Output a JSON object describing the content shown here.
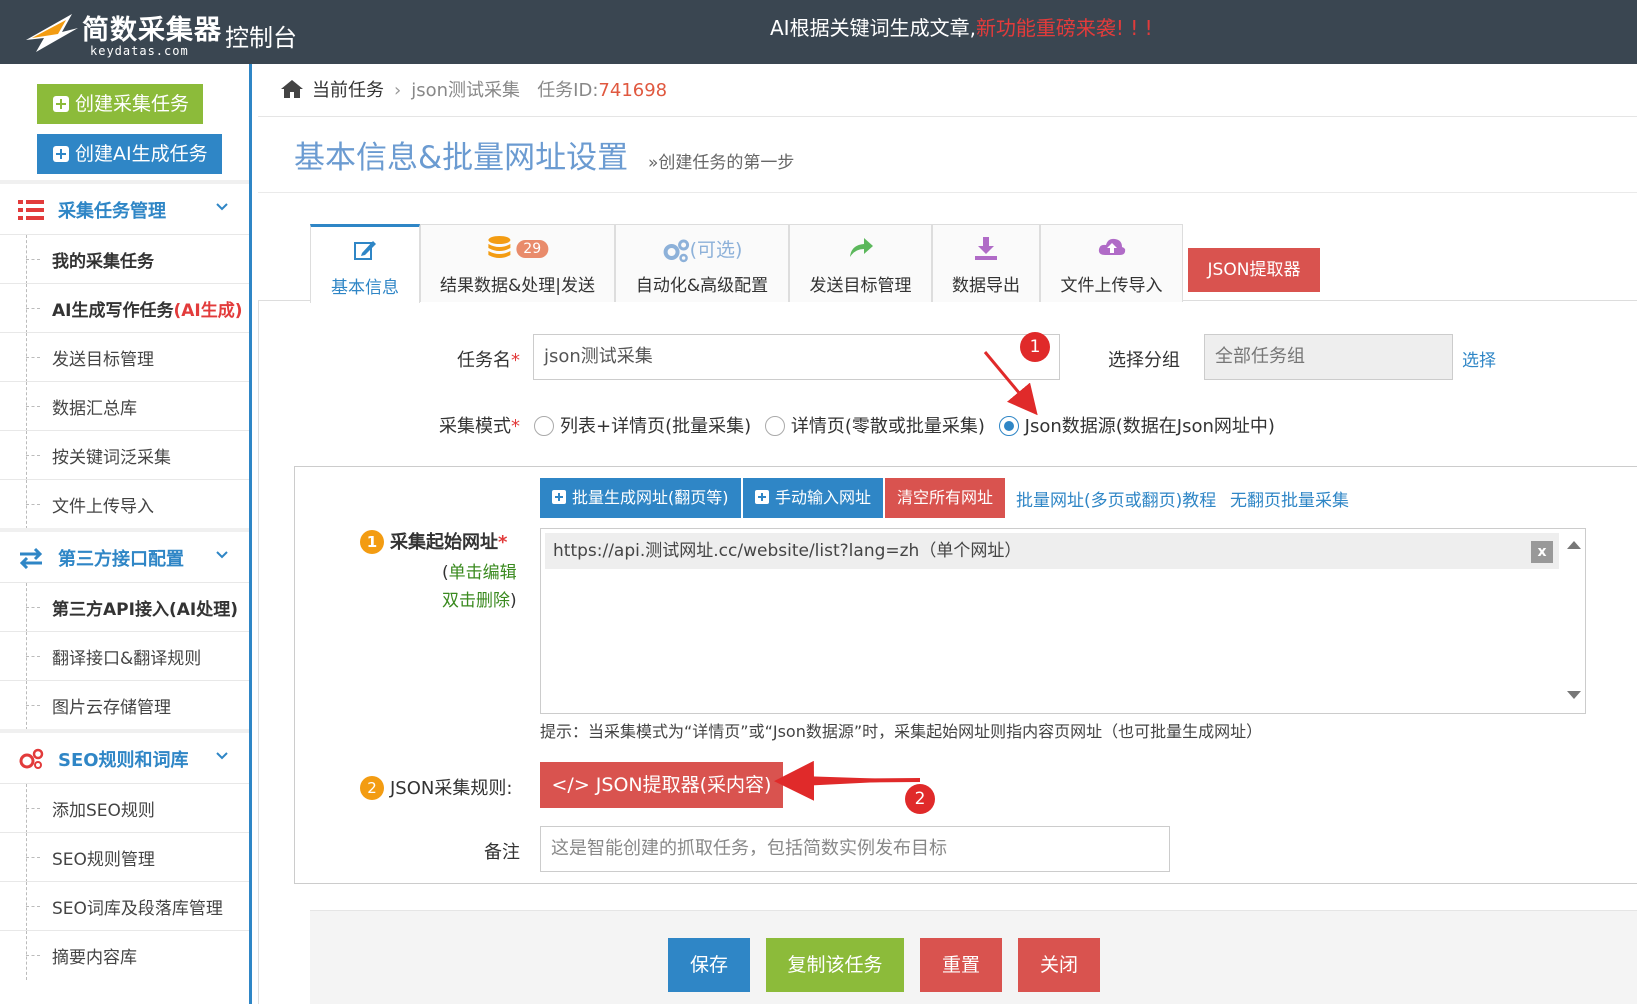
{
  "header": {
    "logo_text": "简数采集器",
    "logo_sub": "keydatas.com",
    "console_title": "控制台",
    "announce_main": "AI根据关键词生成文章,",
    "announce_hot": "新功能重磅来袭! ! !"
  },
  "sidebar": {
    "create_collect": "创建采集任务",
    "create_ai": "创建AI生成任务",
    "groups": [
      {
        "label": "采集任务管理",
        "icon": "list-icon"
      },
      {
        "label": "第三方接口配置",
        "icon": "exchange-icon"
      },
      {
        "label": "SEO规则和词库",
        "icon": "gears-icon"
      }
    ],
    "items_group1": [
      "我的采集任务",
      "AI生成写作任务",
      "发送目标管理",
      "数据汇总库",
      "按关键词泛采集",
      "文件上传导入"
    ],
    "ai_suffix": "(AI生成)",
    "items_group2": [
      "第三方API接入(AI处理)",
      "翻译接口&翻译规则",
      "图片云存储管理"
    ],
    "items_group3": [
      "添加SEO规则",
      "SEO规则管理",
      "SEO词库及段落库管理",
      "摘要内容库"
    ]
  },
  "breadcrumb": {
    "current": "当前任务",
    "task_name": "json测试采集",
    "task_id_label": "任务ID:",
    "task_id": "741698"
  },
  "page": {
    "title": "基本信息&批量网址设置",
    "subtitle": "»创建任务的第一步"
  },
  "tabs": [
    {
      "label": "基本信息",
      "icon": "edit-icon"
    },
    {
      "label": "结果数据&处理|发送",
      "icon": "database-icon",
      "badge": "29"
    },
    {
      "label": "自动化&高级配置",
      "icon": "gears-icon",
      "extra": "(可选)"
    },
    {
      "label": "发送目标管理",
      "icon": "share-icon"
    },
    {
      "label": "数据导出",
      "icon": "download-icon"
    },
    {
      "label": "文件上传导入",
      "icon": "cloud-upload-icon"
    }
  ],
  "json_tab_button": "JSON提取器",
  "form": {
    "task_name_label": "任务名",
    "task_name_value": "json测试采集",
    "group_label": "选择分组",
    "group_value": "全部任务组",
    "group_select_link": "选择",
    "mode_label": "采集模式",
    "modes": [
      "列表+详情页(批量采集)",
      "详情页(零散或批量采集)",
      "Json数据源(数据在Json网址中)"
    ],
    "mode_selected": 2,
    "btn_batch": "批量生成网址(翻页等)",
    "btn_manual": "手动输入网址",
    "btn_clear": "清空所有网址",
    "link_tutorial": "批量网址(多页或翻页)教程",
    "link_nopage": "无翻页批量采集",
    "start_url_num": "1",
    "start_url_label": "采集起始网址",
    "hint_paren_open": "(",
    "hint_edit": "单击编辑",
    "hint_delete": "双击删除",
    "hint_paren_close": ")",
    "url_item": "https://api.测试网址.cc/website/list?lang=zh（单个网址）",
    "url_remove": "x",
    "tip": "提示：当采集模式为“详情页”或“Json数据源”时，采集起始网址则指内容页网址（也可批量生成网址）",
    "json_rule_num": "2",
    "json_rule_label": "JSON采集规则:",
    "json_btn": "</> JSON提取器(采内容)",
    "remark_label": "备注",
    "remark_placeholder": "这是智能创建的抓取任务，包括简数实例发布目标"
  },
  "annotations": {
    "marker1": "1",
    "marker2": "2"
  },
  "bottom": {
    "save": "保存",
    "copy": "复制该任务",
    "reset": "重置",
    "close": "关闭"
  },
  "colors": {
    "topbar": "#3a4651",
    "primary_blue": "#2f86c6",
    "green": "#8cbb3a",
    "red": "#d9534f",
    "orange": "#f39c12"
  }
}
